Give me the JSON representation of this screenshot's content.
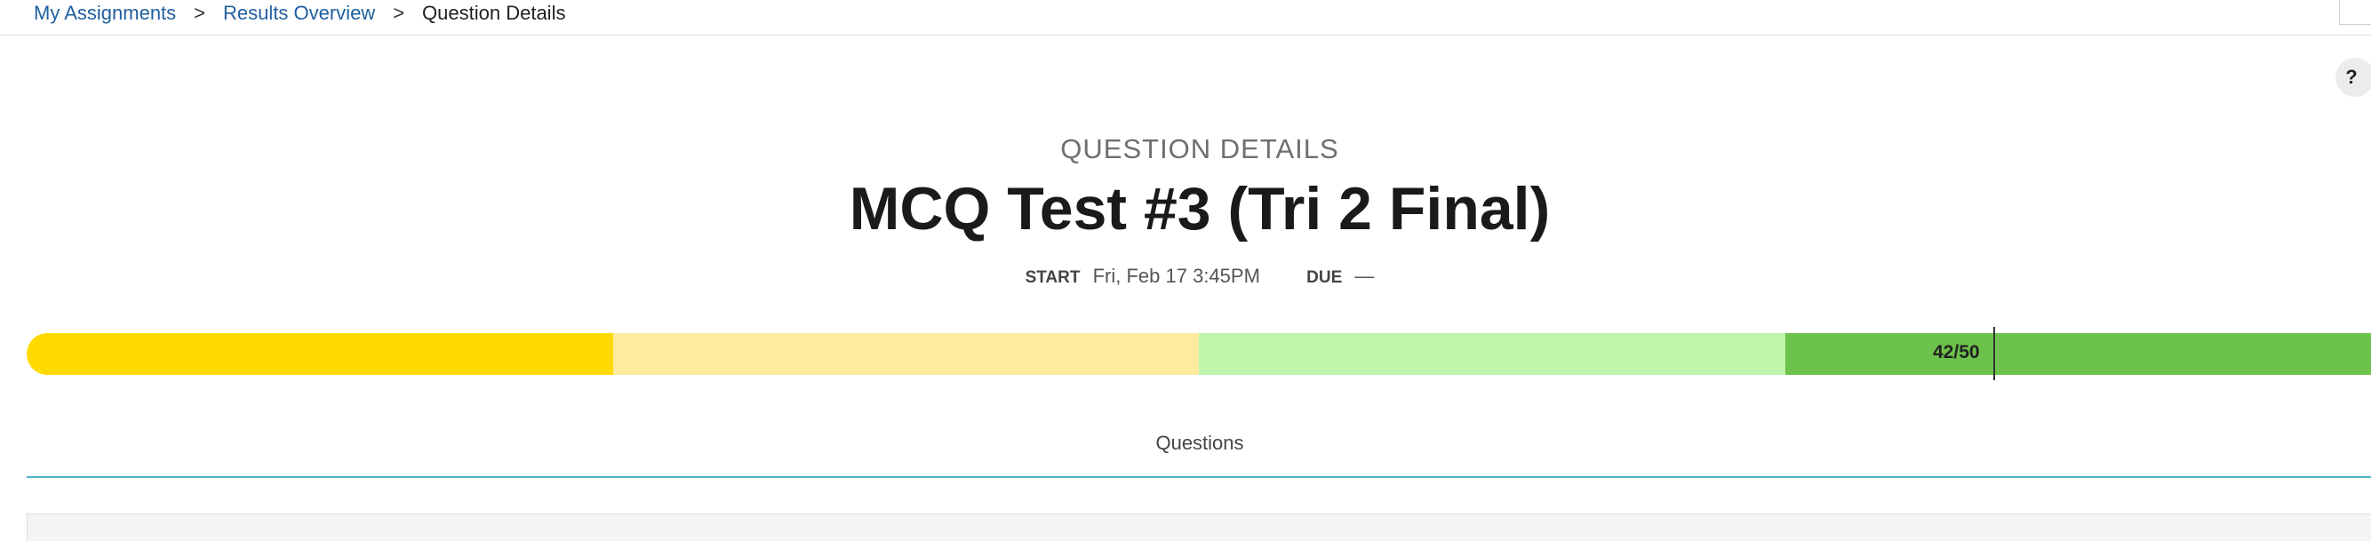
{
  "breadcrumb": {
    "items": [
      {
        "label": "My Assignments"
      },
      {
        "label": "Results Overview"
      }
    ],
    "current": "Question Details",
    "separator": ">"
  },
  "help": {
    "label": "?"
  },
  "header": {
    "eyebrow": "QUESTION DETAILS",
    "title": "MCQ Test #3 (Tri 2 Final)",
    "start_label": "START",
    "start_value": "Fri, Feb 17 3:45PM",
    "due_label": "DUE",
    "due_value": "—"
  },
  "score": {
    "label": "42/50",
    "value": 42,
    "max": 50,
    "bands": [
      {
        "color": "#ffda00"
      },
      {
        "color": "#feeba0"
      },
      {
        "color": "#c0f4aa"
      },
      {
        "color": "#6cc24a"
      }
    ]
  },
  "tabs": {
    "questions": "Questions",
    "accent": "#4fb3c6"
  },
  "colors": {
    "link": "#1f5f9f"
  }
}
